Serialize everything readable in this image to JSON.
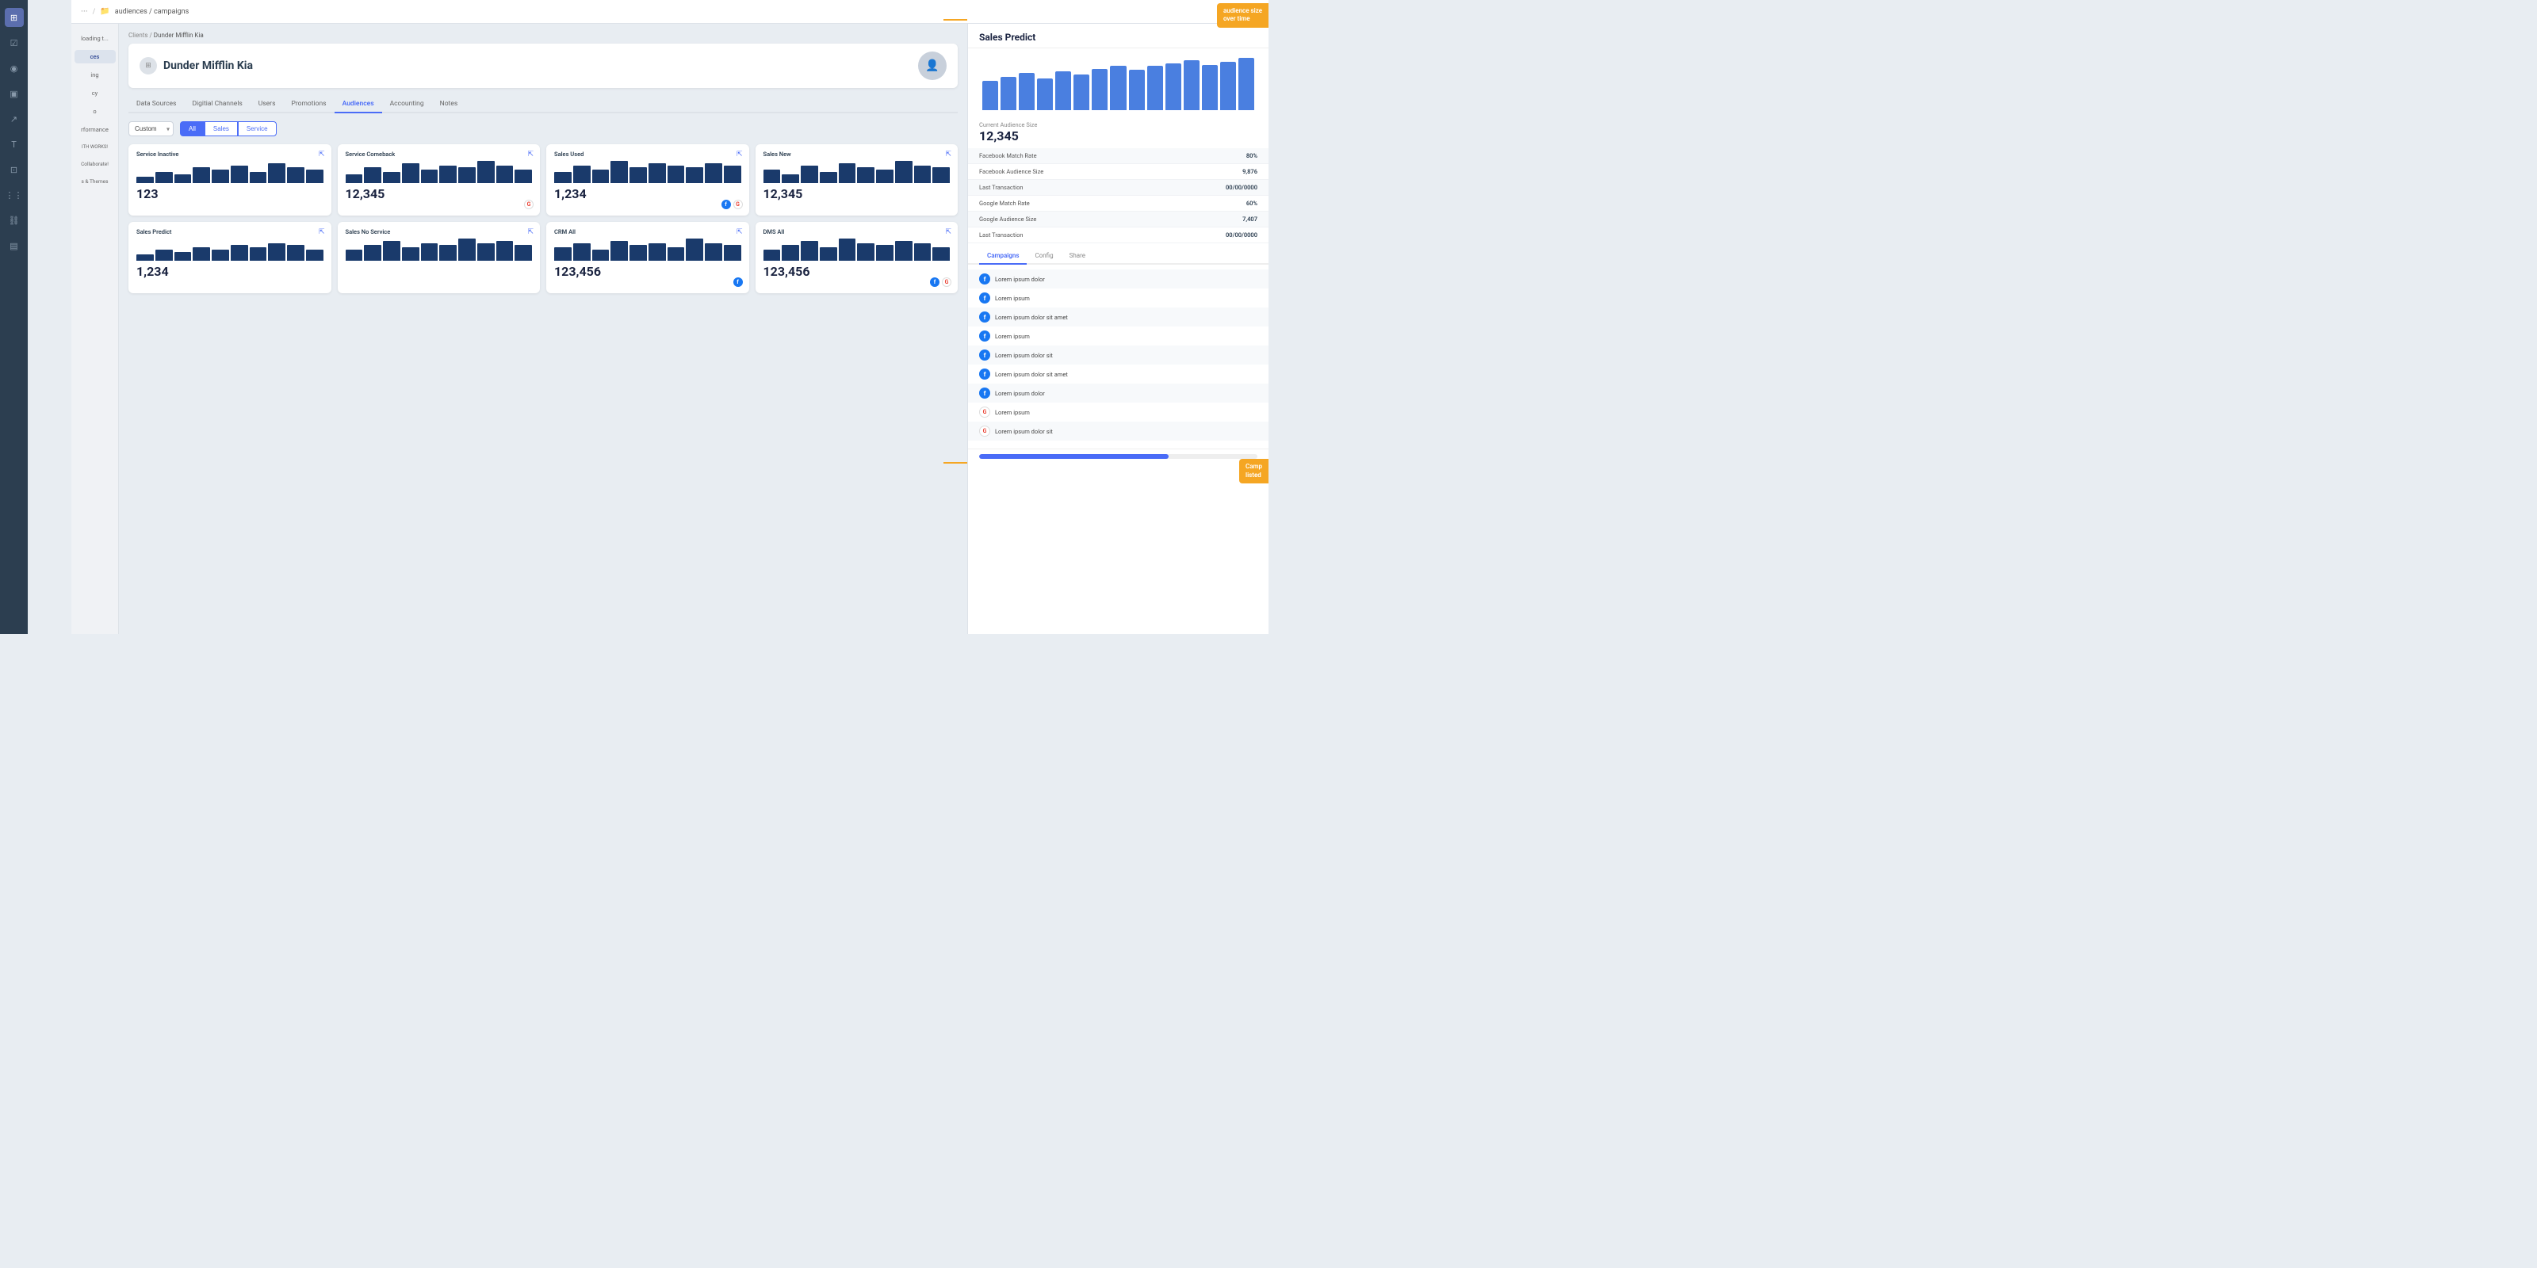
{
  "app": {
    "title": "audiences"
  },
  "topnav": {
    "breadcrumb": "audiences / campaigns",
    "dots": "···",
    "folder_label": "audiences"
  },
  "left_toolbar": {
    "icons": [
      {
        "name": "grid-icon",
        "symbol": "⊞",
        "active": true
      },
      {
        "name": "task-icon",
        "symbol": "☑"
      },
      {
        "name": "eye-icon",
        "symbol": "◉"
      },
      {
        "name": "window-icon",
        "symbol": "▣"
      },
      {
        "name": "arrow-icon",
        "symbol": "↗"
      },
      {
        "name": "text-icon",
        "symbol": "T"
      },
      {
        "name": "image-icon",
        "symbol": "⊡"
      },
      {
        "name": "apps-icon",
        "symbol": "⋮⋮"
      },
      {
        "name": "link-icon",
        "symbol": "⛓"
      },
      {
        "name": "layers-icon",
        "symbol": "▤"
      }
    ]
  },
  "left_panel": {
    "items": [
      {
        "label": "loading t...",
        "active": false
      },
      {
        "label": "ces",
        "active": true
      },
      {
        "label": "ing",
        "active": false
      },
      {
        "label": "cy",
        "active": false
      },
      {
        "label": "o",
        "active": false
      },
      {
        "label": "rformance",
        "active": false
      },
      {
        "label": "ITH WORKS!",
        "active": false
      },
      {
        "label": "Collaborate!",
        "active": false
      },
      {
        "label": "s & Themes",
        "active": false
      }
    ]
  },
  "breadcrumb": {
    "clients": "Clients",
    "separator": "/",
    "current": "Dunder Mifflin Kia"
  },
  "client": {
    "name": "Dunder Mifflin Kia",
    "avatar_symbol": "👤"
  },
  "tabs": [
    {
      "label": "Data Sources",
      "active": false
    },
    {
      "label": "Digitial Channels",
      "active": false
    },
    {
      "label": "Users",
      "active": false
    },
    {
      "label": "Promotions",
      "active": false
    },
    {
      "label": "Audiences",
      "active": true
    },
    {
      "label": "Accounting",
      "active": false
    },
    {
      "label": "Notes",
      "active": false
    }
  ],
  "audience_filter": {
    "custom_label": "Custom",
    "filter_options": [
      {
        "label": "All",
        "active": true
      },
      {
        "label": "Sales",
        "active": false
      },
      {
        "label": "Service",
        "active": false
      }
    ]
  },
  "audience_cards": [
    {
      "title": "Service Inactive",
      "value": "123",
      "has_expand": true,
      "has_icons": false,
      "bars": [
        3,
        5,
        4,
        7,
        6,
        8,
        5,
        9,
        7,
        6
      ]
    },
    {
      "title": "Service Comeback",
      "value": "12,345",
      "has_expand": true,
      "has_icons": false,
      "icon_g": true,
      "bars": [
        4,
        7,
        5,
        9,
        6,
        8,
        7,
        10,
        8,
        6
      ]
    },
    {
      "title": "Sales Used",
      "value": "1,234",
      "has_expand": true,
      "has_icons": true,
      "icon_fb": true,
      "icon_g": true,
      "bars": [
        5,
        8,
        6,
        10,
        7,
        9,
        8,
        7,
        9,
        8
      ]
    },
    {
      "title": "Sales New",
      "value": "12,345",
      "has_expand": true,
      "has_icons": false,
      "bars": [
        6,
        4,
        8,
        5,
        9,
        7,
        6,
        10,
        8,
        7
      ]
    },
    {
      "title": "Sales Predict",
      "value": "1,234",
      "has_expand": true,
      "has_icons": false,
      "bars": [
        3,
        5,
        4,
        6,
        5,
        7,
        6,
        8,
        7,
        5
      ]
    },
    {
      "title": "Sales No Service",
      "value": "",
      "has_expand": true,
      "has_icons": false,
      "bars": [
        5,
        7,
        9,
        6,
        8,
        7,
        10,
        8,
        9,
        7
      ]
    },
    {
      "title": "CRM All",
      "value": "123,456",
      "has_expand": true,
      "has_icons": true,
      "icon_fb": true,
      "icon_g": false,
      "bars": [
        6,
        8,
        5,
        9,
        7,
        8,
        6,
        10,
        8,
        7
      ]
    },
    {
      "title": "DMS All",
      "value": "123,456",
      "has_expand": true,
      "has_icons": true,
      "icon_fb": true,
      "icon_g": true,
      "bars": [
        5,
        7,
        9,
        6,
        10,
        8,
        7,
        9,
        8,
        6
      ]
    }
  ],
  "right_panel": {
    "title": "Sales Predict",
    "audience_size_label": "Current Audience Size",
    "audience_size_value": "12,345",
    "bar_heights": [
      40,
      50,
      55,
      45,
      60,
      55,
      65,
      70,
      60,
      65,
      70,
      75,
      65,
      70,
      80
    ],
    "stats": [
      {
        "label": "Facebook Match Rate",
        "value": "80%"
      },
      {
        "label": "Facebook Audience Size",
        "value": "9,876"
      },
      {
        "label": "Last Transaction",
        "value": "00/00/0000"
      },
      {
        "label": "Google Match Rate",
        "value": "60%"
      },
      {
        "label": "Google Audience Size",
        "value": "7,407"
      },
      {
        "label": "Last Transaction",
        "value": "00/00/0000"
      }
    ],
    "sub_tabs": [
      {
        "label": "Campaigns",
        "active": true
      },
      {
        "label": "Config",
        "active": false
      },
      {
        "label": "Share",
        "active": false
      }
    ],
    "campaigns": [
      {
        "type": "fb",
        "name": "Lorem ipsum dolor"
      },
      {
        "type": "fb",
        "name": "Lorem ipsum"
      },
      {
        "type": "fb",
        "name": "Lorem ipsum dolor sit amet"
      },
      {
        "type": "fb",
        "name": "Lorem ipsum"
      },
      {
        "type": "fb",
        "name": "Lorem ipsum dolor sit"
      },
      {
        "type": "fb",
        "name": "Lorem ipsum dolor sit amet"
      },
      {
        "type": "fb",
        "name": "Lorem ipsum dolor"
      },
      {
        "type": "g",
        "name": "Lorem ipsum"
      },
      {
        "type": "g",
        "name": "Lorem ipsum dolor sit"
      }
    ],
    "progress_value": 68
  },
  "annotations": {
    "top_right": "audience size\nover time",
    "bottom_right": "Camp\nlisted"
  }
}
